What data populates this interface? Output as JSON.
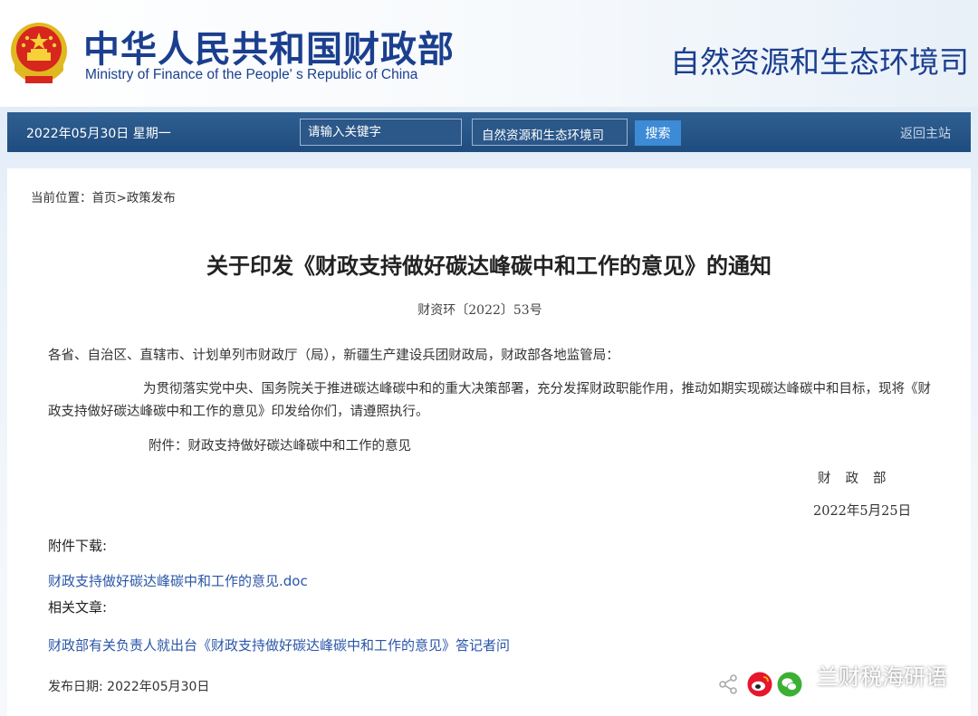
{
  "header": {
    "ministry_cn": "中华人民共和国财政部",
    "ministry_en": "Ministry of Finance of the People' s Republic of China",
    "department": "自然资源和生态环境司",
    "emblem_icon": "national-emblem-icon"
  },
  "navbar": {
    "date": "2022年05月30日  星期一",
    "search_placeholder": "请输入关键字",
    "scope_value": "自然资源和生态环境司",
    "search_button": "搜索",
    "home_link": "返回主站"
  },
  "breadcrumb": "当前位置：首页>政策发布",
  "article": {
    "title": "关于印发《财政支持做好碳达峰碳中和工作的意见》的通知",
    "doc_number": "财资环〔2022〕53号",
    "recipients": "各省、自治区、直辖市、计划单列市财政厅（局），新疆生产建设兵团财政局，财政部各地监管局：",
    "paragraph": "为贯彻落实党中央、国务院关于推进碳达峰碳中和的重大决策部署，充分发挥财政职能作用，推动如期实现碳达峰碳中和目标，现将《财政支持做好碳达峰碳中和工作的意见》印发给你们，请遵照执行。",
    "attachment_note": "附件：财政支持做好碳达峰碳中和工作的意见",
    "signer": "财政部",
    "sign_date": "2022年5月25日"
  },
  "downloads": {
    "label": "附件下载:",
    "file": "财政支持做好碳达峰碳中和工作的意见.doc"
  },
  "related": {
    "label": "相关文章:",
    "article": "财政部有关负责人就出台《财政支持做好碳达峰碳中和工作的意见》答记者问"
  },
  "publish_date": "发布日期:  2022年05月30日",
  "share": {
    "icons": [
      "share-icon",
      "weibo-icon",
      "wechat-icon"
    ]
  },
  "watermark": "兰财税海研语",
  "colors": {
    "brand_blue": "#1b3f8f",
    "nav_bar": "#1f4c7e",
    "search_button": "#3d8bd6",
    "link": "#2a55a8"
  }
}
